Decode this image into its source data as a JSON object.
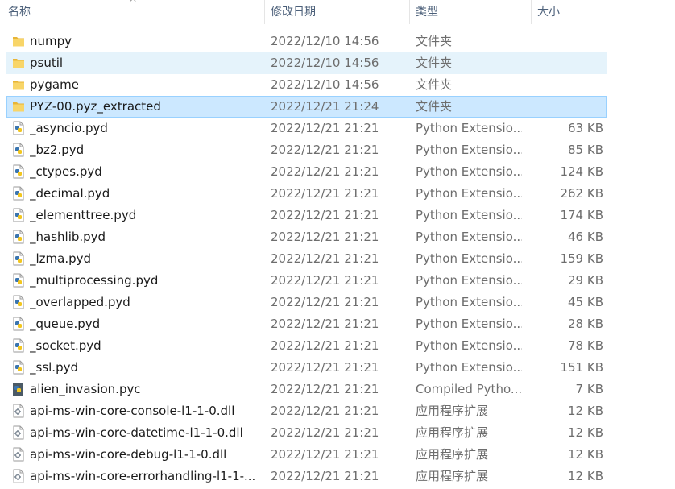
{
  "columns": {
    "name": "名称",
    "date": "修改日期",
    "type": "类型",
    "size": "大小"
  },
  "sort_indicator": "^",
  "files": [
    {
      "name": "numpy",
      "date": "2022/12/10 14:56",
      "type": "文件夹",
      "size": "",
      "icon": "folder-icon",
      "state": ""
    },
    {
      "name": "psutil",
      "date": "2022/12/10 14:56",
      "type": "文件夹",
      "size": "",
      "icon": "folder-icon",
      "state": "hover"
    },
    {
      "name": "pygame",
      "date": "2022/12/10 14:56",
      "type": "文件夹",
      "size": "",
      "icon": "folder-icon",
      "state": ""
    },
    {
      "name": "PYZ-00.pyz_extracted",
      "date": "2022/12/21 21:24",
      "type": "文件夹",
      "size": "",
      "icon": "folder-icon",
      "state": "selected"
    },
    {
      "name": "_asyncio.pyd",
      "date": "2022/12/21 21:21",
      "type": "Python Extensio...",
      "size": "63 KB",
      "icon": "python-file-icon",
      "state": ""
    },
    {
      "name": "_bz2.pyd",
      "date": "2022/12/21 21:21",
      "type": "Python Extensio...",
      "size": "85 KB",
      "icon": "python-file-icon",
      "state": ""
    },
    {
      "name": "_ctypes.pyd",
      "date": "2022/12/21 21:21",
      "type": "Python Extensio...",
      "size": "124 KB",
      "icon": "python-file-icon",
      "state": ""
    },
    {
      "name": "_decimal.pyd",
      "date": "2022/12/21 21:21",
      "type": "Python Extensio...",
      "size": "262 KB",
      "icon": "python-file-icon",
      "state": ""
    },
    {
      "name": "_elementtree.pyd",
      "date": "2022/12/21 21:21",
      "type": "Python Extensio...",
      "size": "174 KB",
      "icon": "python-file-icon",
      "state": ""
    },
    {
      "name": "_hashlib.pyd",
      "date": "2022/12/21 21:21",
      "type": "Python Extensio...",
      "size": "46 KB",
      "icon": "python-file-icon",
      "state": ""
    },
    {
      "name": "_lzma.pyd",
      "date": "2022/12/21 21:21",
      "type": "Python Extensio...",
      "size": "159 KB",
      "icon": "python-file-icon",
      "state": ""
    },
    {
      "name": "_multiprocessing.pyd",
      "date": "2022/12/21 21:21",
      "type": "Python Extensio...",
      "size": "29 KB",
      "icon": "python-file-icon",
      "state": ""
    },
    {
      "name": "_overlapped.pyd",
      "date": "2022/12/21 21:21",
      "type": "Python Extensio...",
      "size": "45 KB",
      "icon": "python-file-icon",
      "state": ""
    },
    {
      "name": "_queue.pyd",
      "date": "2022/12/21 21:21",
      "type": "Python Extensio...",
      "size": "28 KB",
      "icon": "python-file-icon",
      "state": ""
    },
    {
      "name": "_socket.pyd",
      "date": "2022/12/21 21:21",
      "type": "Python Extensio...",
      "size": "78 KB",
      "icon": "python-file-icon",
      "state": ""
    },
    {
      "name": "_ssl.pyd",
      "date": "2022/12/21 21:21",
      "type": "Python Extensio...",
      "size": "151 KB",
      "icon": "python-file-icon",
      "state": ""
    },
    {
      "name": "alien_invasion.pyc",
      "date": "2022/12/21 21:21",
      "type": "Compiled Pytho...",
      "size": "7 KB",
      "icon": "compiled-python-icon",
      "state": ""
    },
    {
      "name": "api-ms-win-core-console-l1-1-0.dll",
      "date": "2022/12/21 21:21",
      "type": "应用程序扩展",
      "size": "12 KB",
      "icon": "dll-file-icon",
      "state": ""
    },
    {
      "name": "api-ms-win-core-datetime-l1-1-0.dll",
      "date": "2022/12/21 21:21",
      "type": "应用程序扩展",
      "size": "12 KB",
      "icon": "dll-file-icon",
      "state": ""
    },
    {
      "name": "api-ms-win-core-debug-l1-1-0.dll",
      "date": "2022/12/21 21:21",
      "type": "应用程序扩展",
      "size": "12 KB",
      "icon": "dll-file-icon",
      "state": ""
    },
    {
      "name": "api-ms-win-core-errorhandling-l1-1-...",
      "date": "2022/12/21 21:21",
      "type": "应用程序扩展",
      "size": "12 KB",
      "icon": "dll-file-icon",
      "state": ""
    }
  ]
}
